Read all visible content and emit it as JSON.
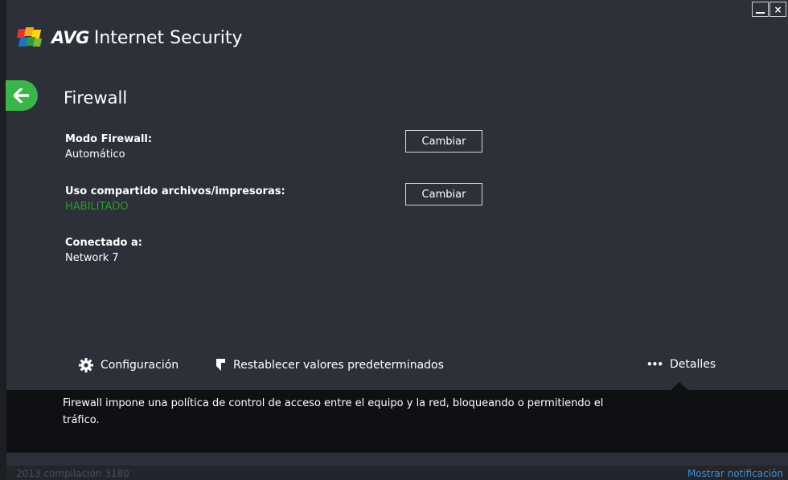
{
  "window": {
    "minimize_label": "",
    "close_label": "×"
  },
  "header": {
    "brand_strong": "AVG",
    "brand_rest": "Internet Security"
  },
  "page": {
    "title": "Firewall"
  },
  "fields": {
    "mode_label": "Modo Firewall:",
    "mode_value": "Automático",
    "sharing_label": "Uso compartido archivos/impresoras:",
    "sharing_value": "HABILITADO",
    "connected_label": "Conectado a:",
    "connected_value": "Network 7"
  },
  "buttons": {
    "change_mode": "Cambiar",
    "change_sharing": "Cambiar"
  },
  "toolbar": {
    "settings_label": "Configuración",
    "reset_label": "Restablecer valores predeterminados",
    "details_label": "Detalles"
  },
  "info": {
    "description": "Firewall impone una política de control de acceso entre el equipo y la red, bloqueando o permitiendo el tráfico."
  },
  "status": {
    "build": "2013 compilación 3180",
    "show_notification": "Mostrar notificación"
  },
  "colors": {
    "background": "#2d3039",
    "accent_green": "#3ab54a",
    "enabled_green": "#2a9a2a",
    "info_bar": "#0f1013",
    "link_blue": "#3d8fd1"
  },
  "icons": {
    "back": "arrow-left-icon",
    "settings": "gear-icon",
    "reset": "reset-icon",
    "details": "ellipsis-icon",
    "logo": "avg-logo-icon"
  }
}
